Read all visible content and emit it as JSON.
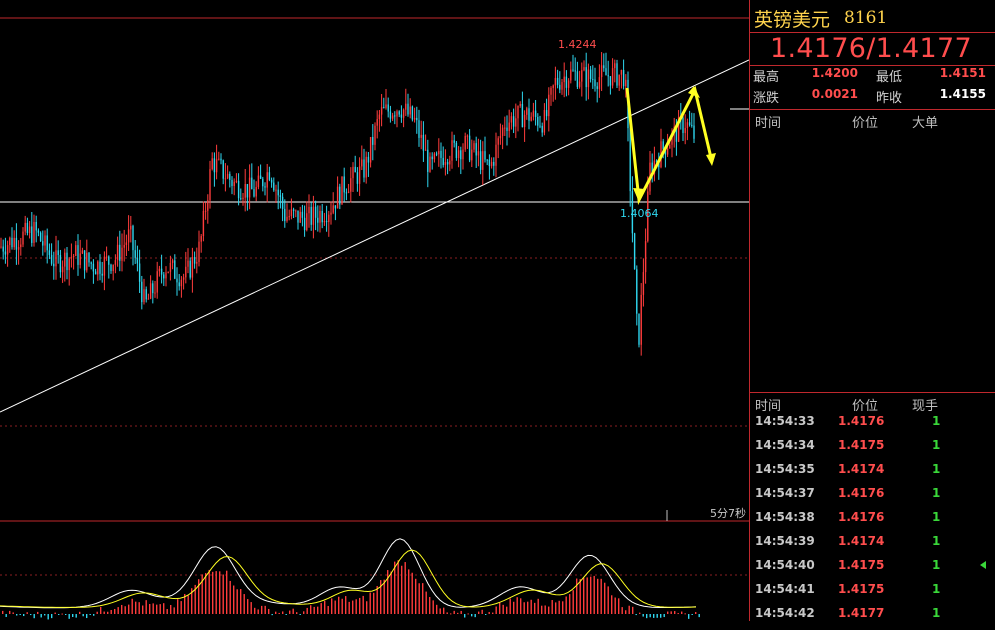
{
  "quote": {
    "symbol_name": "英镑美元",
    "symbol_code": "8161",
    "price": "1.4176/1.4177",
    "high_label": "最高",
    "high": "1.4200",
    "low_label": "最低",
    "low": "1.4151",
    "change_label": "涨跌",
    "change": "0.0021",
    "prev_close_label": "昨收",
    "prev_close": "1.4155"
  },
  "upper_table": {
    "headers": [
      "时间",
      "价位",
      "大单"
    ]
  },
  "lower_table": {
    "headers": [
      "时间",
      "价位",
      "现手"
    ],
    "rows": [
      {
        "time": "14:54:33",
        "price": "1.4176",
        "qty": "1"
      },
      {
        "time": "14:54:34",
        "price": "1.4175",
        "qty": "1"
      },
      {
        "time": "14:54:35",
        "price": "1.4174",
        "qty": "1"
      },
      {
        "time": "14:54:37",
        "price": "1.4176",
        "qty": "1"
      },
      {
        "time": "14:54:38",
        "price": "1.4176",
        "qty": "1"
      },
      {
        "time": "14:54:39",
        "price": "1.4174",
        "qty": "1"
      },
      {
        "time": "14:54:40",
        "price": "1.4175",
        "qty": "1"
      },
      {
        "time": "14:54:41",
        "price": "1.4175",
        "qty": "1"
      },
      {
        "time": "14:54:42",
        "price": "1.4177",
        "qty": "1"
      }
    ]
  },
  "chart": {
    "high_label": "1.4244",
    "low_label": "1.4064",
    "timer": "5分7秒"
  },
  "chart_data": {
    "type": "candlestick",
    "points": [
      [
        0,
        1.413
      ],
      [
        15,
        1.4135
      ],
      [
        35,
        1.414
      ],
      [
        55,
        1.412
      ],
      [
        75,
        1.4125
      ],
      [
        95,
        1.4118
      ],
      [
        115,
        1.4122
      ],
      [
        130,
        1.4138
      ],
      [
        145,
        1.4092
      ],
      [
        165,
        1.4118
      ],
      [
        185,
        1.411
      ],
      [
        200,
        1.413
      ],
      [
        212,
        1.4185
      ],
      [
        235,
        1.417
      ],
      [
        255,
        1.4165
      ],
      [
        270,
        1.418
      ],
      [
        285,
        1.415
      ],
      [
        310,
        1.4148
      ],
      [
        330,
        1.4155
      ],
      [
        345,
        1.417
      ],
      [
        365,
        1.418
      ],
      [
        380,
        1.4215
      ],
      [
        400,
        1.422
      ],
      [
        415,
        1.421
      ],
      [
        430,
        1.418
      ],
      [
        445,
        1.419
      ],
      [
        465,
        1.4195
      ],
      [
        490,
        1.418
      ],
      [
        505,
        1.421
      ],
      [
        525,
        1.4215
      ],
      [
        545,
        1.421
      ],
      [
        555,
        1.4235
      ],
      [
        570,
        1.4241
      ],
      [
        590,
        1.4238
      ],
      [
        610,
        1.424
      ],
      [
        625,
        1.424
      ],
      [
        638,
        1.4064
      ],
      [
        650,
        1.418
      ],
      [
        665,
        1.4195
      ],
      [
        685,
        1.421
      ],
      [
        695,
        1.42
      ]
    ],
    "colors": {
      "up": "#ff3c3c",
      "down": "#2fd7ef"
    },
    "ylim": [
      1.4,
      1.427
    ]
  },
  "colors": {
    "accent": "#c0282d",
    "bid": "#ff4d4d",
    "qty": "#3ad83a",
    "title": "#ffd34d",
    "annotation": "#ffff22"
  }
}
